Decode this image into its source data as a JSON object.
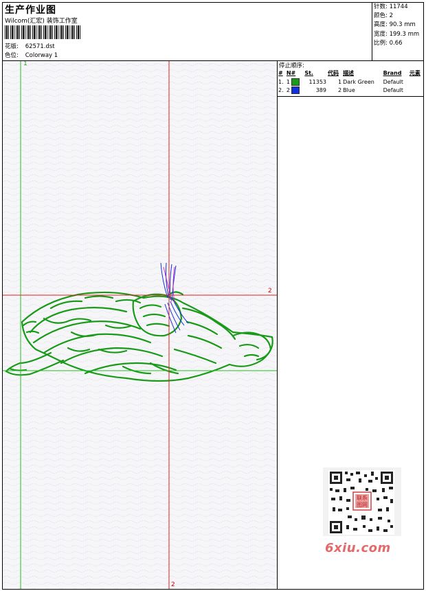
{
  "header": {
    "title": "生产作业图",
    "company": "Wilcom(汇宏) 装饰工作室",
    "design_label": "花版:",
    "design_value": "62571.dst",
    "colorway_label": "色位:",
    "colorway_value": "Colorway 1"
  },
  "stats": [
    {
      "label": "针数:",
      "value": "11744"
    },
    {
      "label": "颜色:",
      "value": "2"
    },
    {
      "label": "高度:",
      "value": "90.3 mm"
    },
    {
      "label": "宽度:",
      "value": "199.3 mm"
    },
    {
      "label": "比例:",
      "value": "0.66"
    }
  ],
  "stop_sequence": {
    "title": "停止顺序:",
    "columns": [
      "#",
      "N#",
      "St.",
      "代码",
      "描述",
      "Brand",
      "元素"
    ],
    "rows": [
      {
        "index": "1.",
        "n": "1",
        "color": "#1a9a1a",
        "stitches": "11353",
        "code": "1",
        "description": "Dark Green",
        "brand": "Default"
      },
      {
        "index": "2.",
        "n": "2",
        "color": "#1030e0",
        "stitches": "389",
        "code": "2",
        "description": "Blue",
        "brand": "Default"
      }
    ]
  },
  "canvas": {
    "corner_label": "1",
    "hline_label": "2",
    "vline_label": "2",
    "colors": {
      "guide_red": "#e02020",
      "guide_green": "#20c020",
      "stitch_green": "#1a9a1a",
      "stitch_blue": "#1030e0"
    }
  },
  "watermark": {
    "text": "6xiu.com",
    "stamp_text": "联系图网"
  }
}
